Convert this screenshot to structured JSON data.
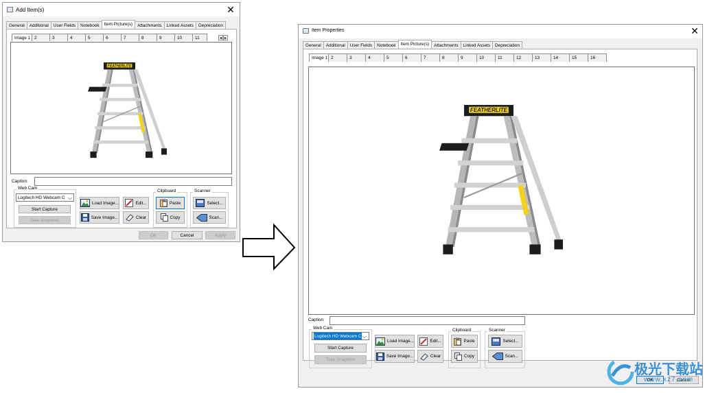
{
  "left_dialog": {
    "title": "Add Item(s)",
    "close": "✕",
    "tabs": [
      "General",
      "Additional",
      "User Fields",
      "Notebook",
      "Item Picture(s)",
      "Attachments",
      "Linked Assets",
      "Depreciation"
    ],
    "active_tab": 4,
    "image_tabs": [
      "Image 1",
      "2",
      "3",
      "4",
      "5",
      "6",
      "7",
      "8",
      "9",
      "10",
      "11"
    ],
    "spin_left": "◂",
    "spin_right": "▸",
    "ladder_brand": "FEATHERLITE",
    "caption_label": "Caption:",
    "caption_value": "",
    "webcam": {
      "label": "Web Cam",
      "device": "Logitech HD Webcam C",
      "start_capture": "Start Capture",
      "take_snapshot": "Take Snapshot"
    },
    "load_image": "Load Image...",
    "save_image": "Save Image...",
    "edit": "Edit...",
    "clear": "Clear",
    "clipboard": {
      "label": "Clipboard",
      "paste": "Paste",
      "copy": "Copy"
    },
    "scanner": {
      "label": "Scanner",
      "select": "Select...",
      "scan": "Scan..."
    },
    "ok": "OK",
    "cancel": "Cancel",
    "apply": "Apply"
  },
  "right_dialog": {
    "title": "Item Properties",
    "close": "✕",
    "tabs": [
      "General",
      "Additional",
      "User Fields",
      "Notebook",
      "Item Picture(s)",
      "Attachments",
      "Linked Assets",
      "Depreciation"
    ],
    "active_tab": 4,
    "image_tabs": [
      "Image 1",
      "2",
      "3",
      "4",
      "5",
      "6",
      "7",
      "8",
      "9",
      "10",
      "11",
      "12",
      "13",
      "14",
      "15",
      "16"
    ],
    "ladder_brand": "FEATHERLITE",
    "caption_label": "Caption:",
    "caption_value": "",
    "webcam": {
      "label": "Web Cam",
      "device": "Logitech HD Webcam C",
      "start_capture": "Start Capture",
      "take_snapshot": "Take Snapshot"
    },
    "load_image": "Load Image...",
    "save_image": "Save Image...",
    "edit": "Edit...",
    "clear": "Clear",
    "clipboard": {
      "label": "Clipboard",
      "paste": "Paste",
      "copy": "Copy"
    },
    "scanner": {
      "label": "Scanner",
      "select": "Select...",
      "scan": "Scan..."
    },
    "ok": "OK",
    "cancel": "Cancel"
  },
  "watermark": {
    "text": "极光下载站",
    "url": "www.xz7.com"
  },
  "colors": {
    "selection": "#0078d7",
    "ladder_label": "#f2d21b",
    "dialog_bg": "#f0f0f0"
  }
}
